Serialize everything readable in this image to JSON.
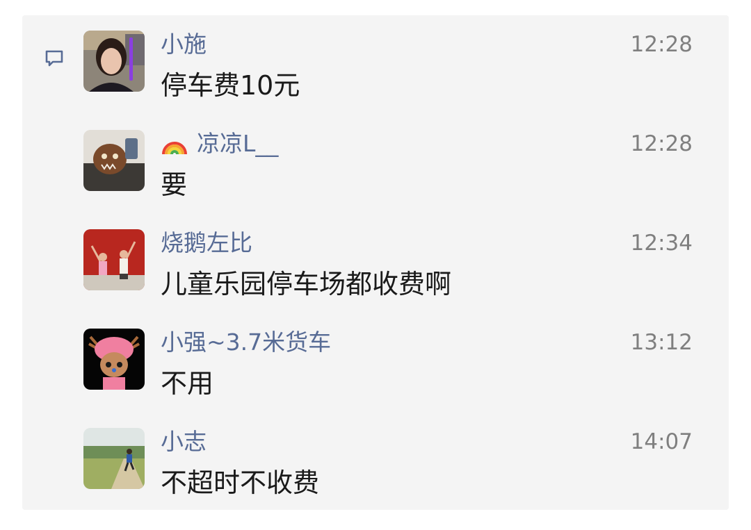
{
  "comments": [
    {
      "name": "小施",
      "time": "12:28",
      "text": "停车费10元",
      "avatar": "woman-avatar"
    },
    {
      "name": "凉凉L__",
      "time": "12:28",
      "text": "要",
      "avatar": "cartoon-monster-avatar",
      "name_emoji": "rainbow-icon"
    },
    {
      "name": "烧鹅左比",
      "time": "12:34",
      "text": "儿童乐园停车场都收费啊",
      "avatar": "kids-avatar"
    },
    {
      "name": "小强~3.7米货车",
      "time": "13:12",
      "text": "不用",
      "avatar": "chopper-avatar"
    },
    {
      "name": "小志",
      "time": "14:07",
      "text": "不超时不收费",
      "avatar": "runner-avatar"
    }
  ],
  "colors": {
    "name": "#576b95",
    "time": "#7f7f7f",
    "text": "#1a1a1a",
    "panel": "#f4f4f4"
  }
}
